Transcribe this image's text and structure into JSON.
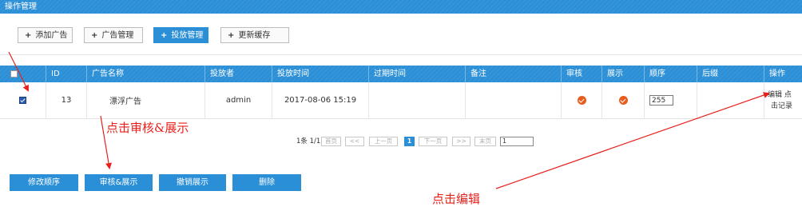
{
  "header": {
    "title": "操作管理"
  },
  "toolbar": {
    "add_label": "添加广告",
    "manage_label": "广告管理",
    "deliver_label": "投放管理",
    "cache_label": "更新缓存"
  },
  "table": {
    "columns": [
      "ID",
      "广告名称",
      "投放者",
      "投放时间",
      "过期时间",
      "备注",
      "审核",
      "展示",
      "顺序",
      "后缀",
      "操作"
    ],
    "row": {
      "id": "13",
      "name": "漂浮广告",
      "publisher": "admin",
      "start_time": "2017-08-06 15:19",
      "expire_time": "",
      "note": "",
      "order": "255",
      "suffix": "",
      "ops_line1": "编辑 点",
      "ops_line2": "击记录"
    }
  },
  "pager": {
    "summary": "1条 1/1页",
    "first": "首页",
    "prev2": "<<",
    "prev": "上一页",
    "current": "1",
    "next": "下一页",
    "next2": ">>",
    "last": "末页",
    "jump_value": "1"
  },
  "bottom_buttons": {
    "modify_order": "修改顺序",
    "approve_show": "审核&展示",
    "revoke_show": "撤销展示",
    "delete": "删除"
  },
  "annotations": {
    "click_approve": "点击审核&展示",
    "click_edit": "点击编辑"
  },
  "colors": {
    "primary": "#2a8fd6",
    "annotation": "#e8201b",
    "status_ok": "#e85d1f"
  }
}
